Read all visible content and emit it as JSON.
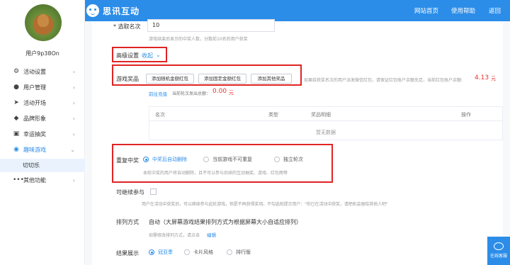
{
  "app": {
    "title": "思讯互动",
    "nav": [
      "网站首页",
      "使用帮助",
      "返回"
    ]
  },
  "user": {
    "name": "用户9p38On"
  },
  "sidebar": {
    "items": [
      {
        "label": "活动设置",
        "icon": "gear-icon"
      },
      {
        "label": "用户管理",
        "icon": "user-icon"
      },
      {
        "label": "活动开场",
        "icon": "send-icon"
      },
      {
        "label": "品牌形象",
        "icon": "brand-icon"
      },
      {
        "label": "幸运抽奖",
        "icon": "lottery-icon"
      },
      {
        "label": "趣味游戏",
        "icon": "game-icon"
      },
      {
        "label": "其他功能",
        "icon": "more-icon"
      }
    ],
    "sub_item": "切切乐"
  },
  "form": {
    "rank_label": "* 选取名次",
    "rank_value": "10",
    "rank_hint": "游戏结束后显示的中奖人数，分数前10名的用户获奖",
    "advanced_label": "高级设置",
    "advanced_toggle": "收起",
    "prize_label": "游戏奖品",
    "prize_buttons": [
      "添加随机金额红包",
      "添加固定金额红包",
      "添加其他奖品"
    ],
    "prize_hint": "如果给获奖名次的用户派发微信红包，请保证红包账户余额充足，当前红包账户余额:",
    "balance": "4.13",
    "balance_unit": "元",
    "recharge": "前往充值",
    "round_total_label": "当前轮次发出总额：",
    "round_total": "0.00",
    "round_total_unit": "元",
    "table_headers": [
      "名次",
      "类型",
      "奖品明细",
      "操作"
    ],
    "table_empty": "暂无数据",
    "repeat_label": "重复中奖",
    "repeat_options": [
      "中奖后自动删除",
      "当前游戏不可重复",
      "独立轮次"
    ],
    "repeat_selected": 0,
    "repeat_hint": "本轮中奖的用户将自动删除，且不可以参与后续的互动抽奖、游戏、红包雨等",
    "continue_label": "可继续参与",
    "continue_hint": "用户在活动中获奖后，可以继续参与此轮游戏，但是不再获得奖项。不勾选则提示用户：\"你已在活动中获奖，请把机会留给其他人吧\"",
    "sort_label": "排列方式",
    "sort_value": "自动（大屏幕游戏结果排列方式为根据屏幕大小自适应排列）",
    "sort_hint": "如需修改排列方式，请点击",
    "sort_edit": "编辑",
    "result_label": "结果展示",
    "result_options": [
      "冠亚季",
      "卡片风格",
      "排行版"
    ],
    "result_selected": 0
  },
  "online_service": "在线客服",
  "colors": {
    "primary": "#2b8de8",
    "highlight_box": "#e02424",
    "balance": "#e8322f"
  }
}
